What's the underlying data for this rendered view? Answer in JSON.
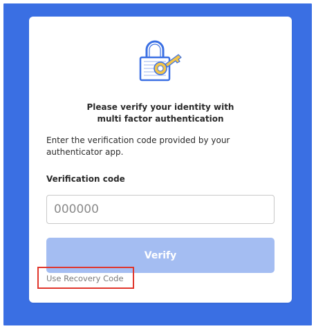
{
  "illustration": {
    "icon": "lock-key-icon",
    "colors": {
      "lock": "#3a6fe3",
      "key": "#f3c54a",
      "lock_fill": "#ffffff"
    }
  },
  "heading": {
    "line1": "Please verify your identity with",
    "line2": "multi factor authentication"
  },
  "instructions": {
    "line1": "Enter the verification code provided by your",
    "line2": "authenticator app."
  },
  "verification": {
    "label": "Verification code",
    "placeholder": "000000",
    "value": ""
  },
  "actions": {
    "verify_label": "Verify",
    "recovery_label": "Use Recovery Code"
  },
  "colors": {
    "background": "#3a6fe3",
    "card": "#ffffff",
    "button_disabled": "#a4bdf2",
    "highlight": "#e0352b"
  }
}
